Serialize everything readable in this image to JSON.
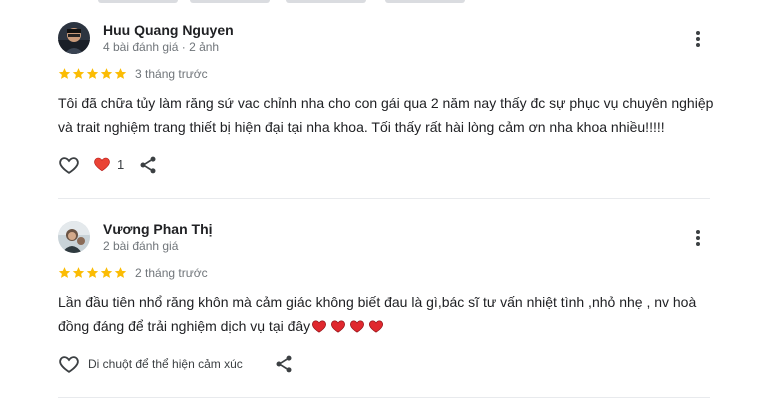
{
  "reviews": [
    {
      "author": "Huu Quang Nguyen",
      "meta": "4 bài đánh giá · 2 ảnh",
      "rating": 5,
      "time": "3 tháng trước",
      "text": "Tôi đã chữa tủy làm răng sứ vac chỉnh nha cho con gái qua 2 năm nay thấy đc sự phục vụ chuyên nghiệp và trait nghiệm trang thiết bị hiện đại tại nha khoa. Tối thấy rất hài lòng cảm ơn nha khoa nhiều!!!!!",
      "reaction_count": "1"
    },
    {
      "author": "Vương Phan Thị",
      "meta": "2 bài đánh giá",
      "rating": 5,
      "time": "2 tháng trước",
      "text": "Lần đầu tiên nhổ răng khôn mà cảm giác không biết đau là gì,bác sĩ tư vấn nhiệt tình ,nhỏ nhẹ , nv hoà đồng đáng để trải nghiệm dịch vụ tại đây",
      "emoji_hearts": 4,
      "hover_hint": "Di chuột để thể hiện cảm xúc"
    }
  ],
  "colors": {
    "star": "#fbbc04",
    "heart": "#ea4335",
    "icon": "#3c4043",
    "secondary_text": "#70757a",
    "divider": "#e8eaed"
  },
  "icons": {
    "more": "more-vert-icon",
    "like": "heart-outline-icon",
    "reaction": "heart-filled-icon",
    "share": "share-icon",
    "star": "star-icon"
  }
}
